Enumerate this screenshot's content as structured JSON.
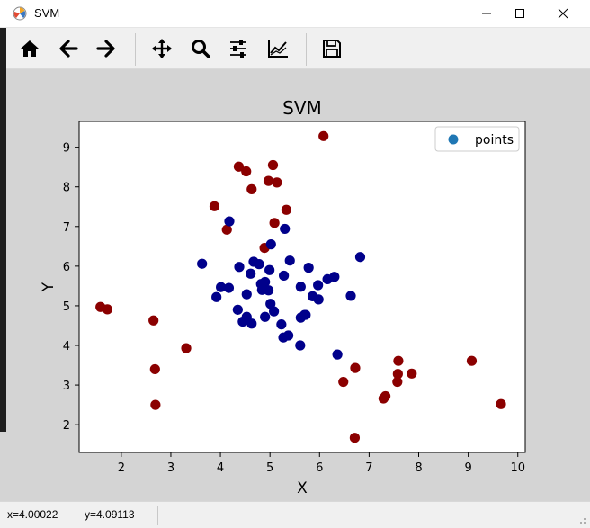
{
  "window": {
    "title": "SVM",
    "app_icon": "matplotlib-icon"
  },
  "toolbar": {
    "buttons": [
      {
        "name": "home-button",
        "icon": "home-icon"
      },
      {
        "name": "back-button",
        "icon": "arrow-left-icon"
      },
      {
        "name": "forward-button",
        "icon": "arrow-right-icon"
      },
      {
        "name": "pan-button",
        "icon": "move-icon"
      },
      {
        "name": "zoom-button",
        "icon": "magnifier-icon"
      },
      {
        "name": "subplots-button",
        "icon": "sliders-icon"
      },
      {
        "name": "edit-axes-button",
        "icon": "chart-line-icon"
      },
      {
        "name": "save-button",
        "icon": "floppy-disk-icon"
      }
    ]
  },
  "status": {
    "x_text": "x=4.00022",
    "y_text": "y=4.09113"
  },
  "colors": {
    "class_inner": "#00008b",
    "class_outer": "#8b0000",
    "legend_marker": "#1f77b4"
  },
  "chart_data": {
    "type": "scatter",
    "title": "SVM",
    "xlabel": "X",
    "ylabel": "Y",
    "xlim": [
      1.15,
      10.15
    ],
    "ylim": [
      1.3,
      9.65
    ],
    "xticks": [
      2,
      3,
      4,
      5,
      6,
      7,
      8,
      9,
      10
    ],
    "yticks": [
      2,
      3,
      4,
      5,
      6,
      7,
      8,
      9
    ],
    "grid": false,
    "legend": {
      "placement": "top-right",
      "entries": [
        "points"
      ]
    },
    "series": [
      {
        "class": "outer",
        "color": "#8b0000",
        "x": [
          6.08,
          4.37,
          4.52,
          5.06,
          4.63,
          4.97,
          5.14,
          3.88,
          5.33,
          4.13,
          5.09,
          4.89,
          1.58,
          1.72,
          2.65,
          3.31,
          2.68,
          2.69,
          7.59,
          7.86,
          7.58,
          7.57,
          6.72,
          6.48,
          7.33,
          7.29,
          9.07,
          9.66,
          6.71
        ],
        "y": [
          9.28,
          8.51,
          8.39,
          8.55,
          7.94,
          8.15,
          8.11,
          7.51,
          7.42,
          6.92,
          7.09,
          6.46,
          4.97,
          4.91,
          4.63,
          3.93,
          3.4,
          2.5,
          3.61,
          3.29,
          3.28,
          3.08,
          3.43,
          3.08,
          2.72,
          2.66,
          3.61,
          2.52,
          1.67
        ]
      },
      {
        "class": "inner",
        "color": "#00008b",
        "x": [
          4.18,
          5.3,
          5.02,
          6.82,
          3.63,
          4.38,
          4.67,
          4.78,
          4.99,
          5.4,
          5.78,
          4.01,
          4.17,
          4.61,
          5.28,
          6.3,
          6.16,
          5.97,
          3.92,
          4.82,
          4.9,
          4.84,
          4.97,
          4.53,
          5.62,
          5.86,
          5.7,
          5.98,
          6.63,
          4.35,
          4.45,
          5.01,
          5.08,
          4.53,
          4.9,
          5.62,
          5.72,
          4.63,
          5.23,
          5.37,
          5.27,
          5.61,
          6.36
        ],
        "y": [
          7.13,
          6.94,
          6.55,
          6.23,
          6.06,
          5.98,
          6.11,
          6.05,
          5.9,
          6.14,
          5.96,
          5.47,
          5.45,
          5.81,
          5.76,
          5.73,
          5.67,
          5.52,
          5.22,
          5.55,
          5.6,
          5.4,
          5.39,
          5.29,
          5.48,
          5.24,
          4.77,
          5.16,
          5.25,
          4.9,
          4.6,
          5.05,
          4.86,
          4.72,
          4.72,
          4.7,
          4.77,
          4.55,
          4.53,
          4.25,
          4.2,
          4.0,
          3.77
        ]
      }
    ]
  }
}
